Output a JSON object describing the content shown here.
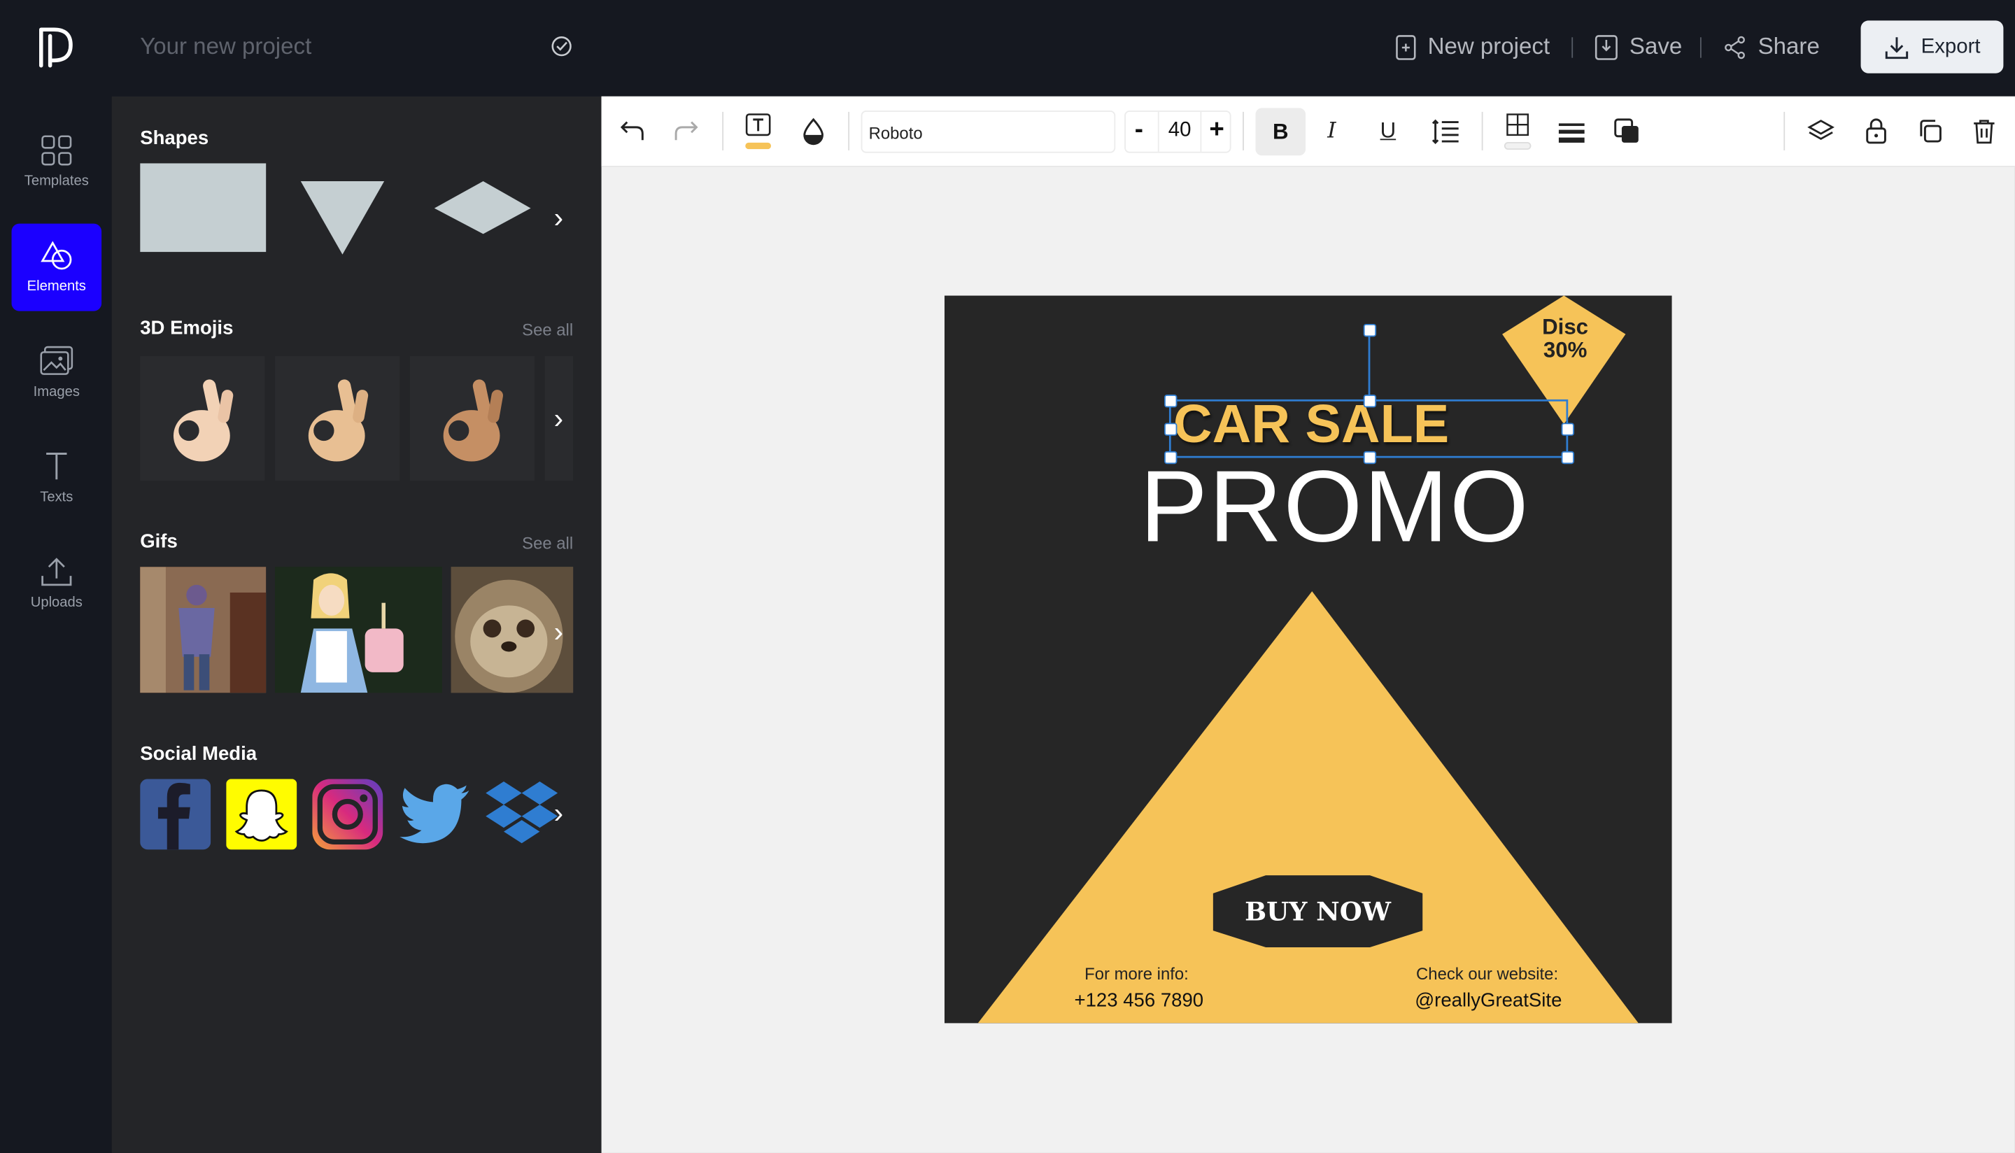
{
  "header": {
    "project_name": "Your new project",
    "new_project_label": "New project",
    "save_label": "Save",
    "share_label": "Share",
    "export_label": "Export"
  },
  "nav": {
    "items": [
      {
        "label": "Templates",
        "icon": "grid-icon"
      },
      {
        "label": "Elements",
        "icon": "shapes-icon",
        "active": true
      },
      {
        "label": "Images",
        "icon": "image-icon"
      },
      {
        "label": "Texts",
        "icon": "text-icon"
      },
      {
        "label": "Uploads",
        "icon": "upload-icon"
      }
    ]
  },
  "panel": {
    "shapes_title": "Shapes",
    "emojis_title": "3D Emojis",
    "emojis_see_all": "See all",
    "gifs_title": "Gifs",
    "gifs_see_all": "See all",
    "social_title": "Social Media"
  },
  "toolbar": {
    "font_family": "Roboto",
    "font_size": "40",
    "minus": "-",
    "plus": "+",
    "bold": "B",
    "italic": "I",
    "underline": "U"
  },
  "design": {
    "heading_top": "CAR SALE",
    "heading_main": "PROMO",
    "badge_line1": "Disc",
    "badge_line2": "30%",
    "cta": "BUY NOW",
    "left_label": "For more info:",
    "left_value": "+123 456 7890",
    "right_label": "Check our website:",
    "right_value": "@reallyGreatSite"
  },
  "colors": {
    "accent": "#1b00ff",
    "brand_yellow": "#f6c358",
    "dark_bg": "#262626"
  }
}
